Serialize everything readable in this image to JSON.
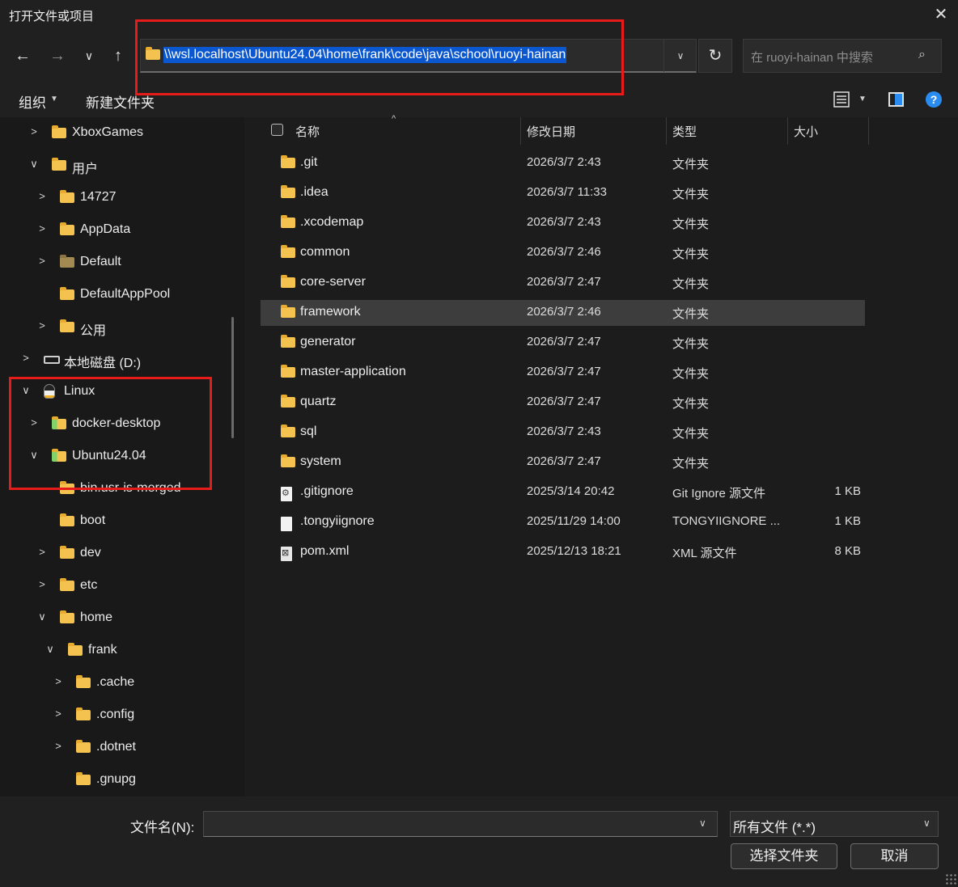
{
  "window": {
    "title": "打开文件或项目",
    "close_icon": "close-icon"
  },
  "nav": {
    "back_icon": "arrow-left-icon",
    "forward_icon": "arrow-right-icon",
    "recent_icon": "chevron-down-icon",
    "up_icon": "arrow-up-icon"
  },
  "address": {
    "path": "\\\\wsl.localhost\\Ubuntu24.04\\home\\frank\\code\\java\\school\\ruoyi-hainan"
  },
  "search": {
    "placeholder": "在 ruoyi-hainan 中搜索"
  },
  "toolbar": {
    "organize": "组织",
    "new_folder": "新建文件夹"
  },
  "sidebar": {
    "items": [
      {
        "label": "XboxGames",
        "chevron": ">",
        "icon": "folder"
      },
      {
        "label": "用户",
        "chevron": "∨",
        "icon": "folder"
      },
      {
        "label": "14727",
        "chevron": ">",
        "icon": "folder"
      },
      {
        "label": "AppData",
        "chevron": ">",
        "icon": "folder"
      },
      {
        "label": "Default",
        "chevron": ">",
        "icon": "folder-dark"
      },
      {
        "label": "DefaultAppPool",
        "chevron": "",
        "icon": "folder"
      },
      {
        "label": "公用",
        "chevron": ">",
        "icon": "folder"
      },
      {
        "label": "本地磁盘 (D:)",
        "chevron": ">",
        "icon": "drive"
      },
      {
        "label": "Linux",
        "chevron": "∨",
        "icon": "tux"
      },
      {
        "label": "docker-desktop",
        "chevron": ">",
        "icon": "folder-linux"
      },
      {
        "label": "Ubuntu24.04",
        "chevron": "∨",
        "icon": "folder-linux"
      },
      {
        "label": "bin.usr-is-merged",
        "chevron": "",
        "icon": "folder"
      },
      {
        "label": "boot",
        "chevron": "",
        "icon": "folder"
      },
      {
        "label": "dev",
        "chevron": ">",
        "icon": "folder"
      },
      {
        "label": "etc",
        "chevron": ">",
        "icon": "folder"
      },
      {
        "label": "home",
        "chevron": "∨",
        "icon": "folder"
      },
      {
        "label": "frank",
        "chevron": "∨",
        "icon": "folder"
      },
      {
        "label": ".cache",
        "chevron": ">",
        "icon": "folder"
      },
      {
        "label": ".config",
        "chevron": ">",
        "icon": "folder"
      },
      {
        "label": ".dotnet",
        "chevron": ">",
        "icon": "folder"
      },
      {
        "label": ".gnupg",
        "chevron": "",
        "icon": "folder"
      }
    ]
  },
  "columns": {
    "name": "名称",
    "modified": "修改日期",
    "type": "类型",
    "size": "大小"
  },
  "files": [
    {
      "name": ".git",
      "date": "2026/3/7 2:43",
      "type": "文件夹",
      "size": "",
      "icon": "folder"
    },
    {
      "name": ".idea",
      "date": "2026/3/7 11:33",
      "type": "文件夹",
      "size": "",
      "icon": "folder"
    },
    {
      "name": ".xcodemap",
      "date": "2026/3/7 2:43",
      "type": "文件夹",
      "size": "",
      "icon": "folder"
    },
    {
      "name": "common",
      "date": "2026/3/7 2:46",
      "type": "文件夹",
      "size": "",
      "icon": "folder"
    },
    {
      "name": "core-server",
      "date": "2026/3/7 2:47",
      "type": "文件夹",
      "size": "",
      "icon": "folder"
    },
    {
      "name": "framework",
      "date": "2026/3/7 2:46",
      "type": "文件夹",
      "size": "",
      "icon": "folder",
      "selected": true
    },
    {
      "name": "generator",
      "date": "2026/3/7 2:47",
      "type": "文件夹",
      "size": "",
      "icon": "folder"
    },
    {
      "name": "master-application",
      "date": "2026/3/7 2:47",
      "type": "文件夹",
      "size": "",
      "icon": "folder"
    },
    {
      "name": "quartz",
      "date": "2026/3/7 2:47",
      "type": "文件夹",
      "size": "",
      "icon": "folder"
    },
    {
      "name": "sql",
      "date": "2026/3/7 2:43",
      "type": "文件夹",
      "size": "",
      "icon": "folder"
    },
    {
      "name": "system",
      "date": "2026/3/7 2:47",
      "type": "文件夹",
      "size": "",
      "icon": "folder"
    },
    {
      "name": ".gitignore",
      "date": "2025/3/14 20:42",
      "type": "Git Ignore 源文件",
      "size": "1 KB",
      "icon": "git-file"
    },
    {
      "name": ".tongyiignore",
      "date": "2025/11/29 14:00",
      "type": "TONGYIIGNORE ...",
      "size": "1 KB",
      "icon": "file"
    },
    {
      "name": "pom.xml",
      "date": "2025/12/13 18:21",
      "type": "XML 源文件",
      "size": "8 KB",
      "icon": "xml-file"
    }
  ],
  "bottom": {
    "filename_label": "文件名(N):",
    "filename_value": "",
    "filter": "所有文件 (*.*)",
    "select_button": "选择文件夹",
    "cancel_button": "取消"
  },
  "colors": {
    "accent": "#0b57d0",
    "highlight_border": "#e81b1b",
    "folder": "#f3c24f"
  }
}
